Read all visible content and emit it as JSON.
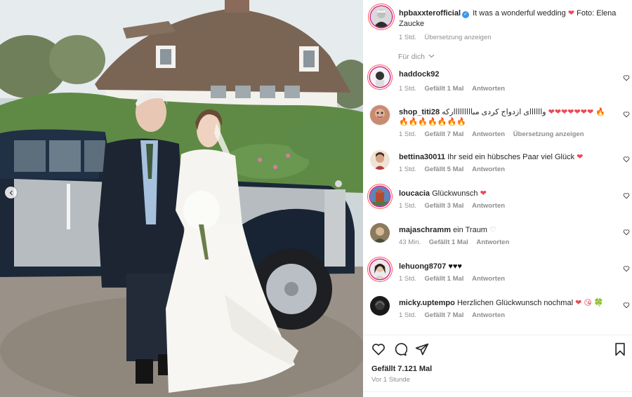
{
  "post": {
    "author": "hpbaxxterofficial",
    "verified_mark": "✓",
    "caption": "It was a wonderful wedding",
    "caption_emoji": "❤",
    "caption_credit": "Foto: Elena Zaucke",
    "time": "1 Std.",
    "translate": "Übersetzung anzeigen",
    "filter_label": "Für dich"
  },
  "comments": [
    {
      "user": "haddock92",
      "text": "",
      "emoji": "",
      "time": "1 Std.",
      "likes": "Gefällt 1 Mal",
      "reply": "Antworten",
      "translate": ""
    },
    {
      "user": "shop_titi28",
      "text": "واااااای ازدواج کردی مبااااااااارکه",
      "emoji": "❤❤❤❤❤❤❤ 🔥🔥🔥🔥🔥🔥🔥🔥",
      "time": "1 Std.",
      "likes": "Gefällt 7 Mal",
      "reply": "Antworten",
      "translate": "Übersetzung anzeigen"
    },
    {
      "user": "bettina30011",
      "text": "Ihr seid ein hübsches Paar viel Glück",
      "emoji": "❤",
      "time": "1 Std.",
      "likes": "Gefällt 5 Mal",
      "reply": "Antworten",
      "translate": ""
    },
    {
      "user": "loucacia",
      "text": "Glückwunsch",
      "emoji": "❤",
      "time": "1 Std.",
      "likes": "Gefällt 3 Mal",
      "reply": "Antworten",
      "translate": ""
    },
    {
      "user": "majaschramm",
      "text": "ein Traum",
      "emoji": "♡",
      "time": "43 Min.",
      "likes": "Gefällt 1 Mal",
      "reply": "Antworten",
      "translate": ""
    },
    {
      "user": "lehuong8707",
      "text": "",
      "emoji": "♥♥♥",
      "time": "1 Std.",
      "likes": "Gefällt 1 Mal",
      "reply": "Antworten",
      "translate": ""
    },
    {
      "user": "micky.uptempo",
      "text": "Herzlichen Glückwunsch nochmal",
      "emoji": "❤ 😘 🍀",
      "time": "1 Std.",
      "likes": "Gefällt 7 Mal",
      "reply": "Antworten",
      "translate": ""
    }
  ],
  "footer": {
    "likes": "Gefällt 7.121 Mal",
    "time": "Vor 1 Stunde"
  },
  "icons": {
    "like": "heart-icon",
    "comment": "comment-bubble-icon",
    "share": "paper-plane-icon",
    "save": "bookmark-icon",
    "prev": "chevron-left-icon",
    "expand": "chevron-down-icon"
  },
  "colors": {
    "accent_red": "#ed4956",
    "verified_blue": "#3897f0",
    "muted_text": "#8e8e8e"
  }
}
